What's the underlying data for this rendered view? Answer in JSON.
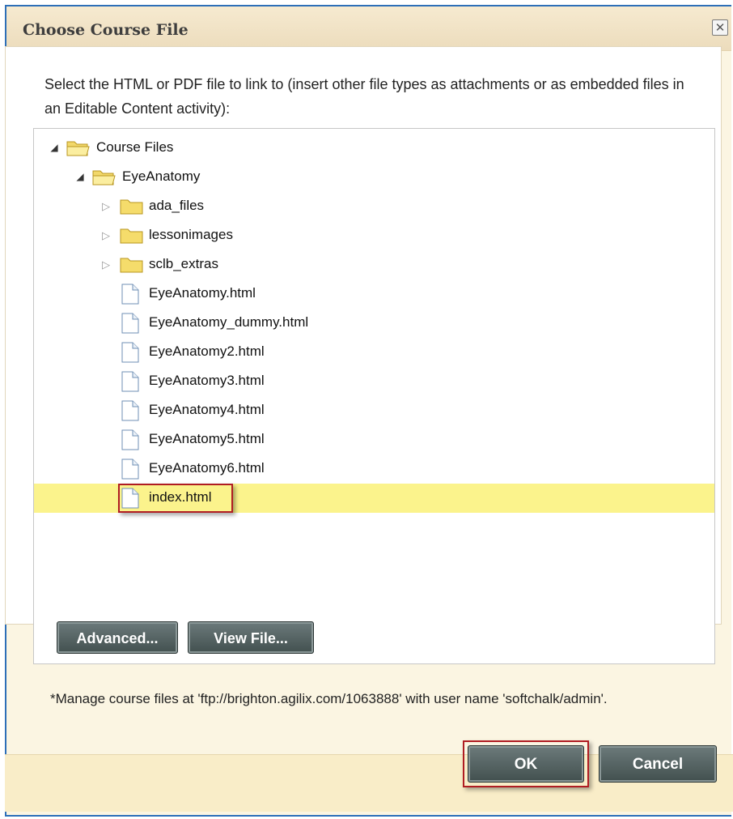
{
  "dialog": {
    "title": "Choose Course File",
    "close_symbol": "✕",
    "instructions": "Select the HTML or PDF file to link to (insert other file types as attachments or as embedded files in an Editable Content activity):",
    "footnote": "*Manage course files at 'ftp://brighton.agilix.com/1063888' with user name 'softchalk/admin'."
  },
  "tree": {
    "items": [
      {
        "label": "Course Files",
        "type": "folder",
        "state": "expanded",
        "depth": 0,
        "icon": "open-folder-icon"
      },
      {
        "label": "EyeAnatomy",
        "type": "folder",
        "state": "expanded",
        "depth": 1,
        "icon": "open-folder-icon"
      },
      {
        "label": "ada_files",
        "type": "folder",
        "state": "collapsed",
        "depth": 2,
        "icon": "folder-icon"
      },
      {
        "label": "lessonimages",
        "type": "folder",
        "state": "collapsed",
        "depth": 2,
        "icon": "folder-icon"
      },
      {
        "label": "sclb_extras",
        "type": "folder",
        "state": "collapsed",
        "depth": 2,
        "icon": "folder-icon"
      },
      {
        "label": "EyeAnatomy.html",
        "type": "file",
        "depth": 2,
        "icon": "file-icon"
      },
      {
        "label": "EyeAnatomy_dummy.html",
        "type": "file",
        "depth": 2,
        "icon": "file-icon"
      },
      {
        "label": "EyeAnatomy2.html",
        "type": "file",
        "depth": 2,
        "icon": "file-icon"
      },
      {
        "label": "EyeAnatomy3.html",
        "type": "file",
        "depth": 2,
        "icon": "file-icon"
      },
      {
        "label": "EyeAnatomy4.html",
        "type": "file",
        "depth": 2,
        "icon": "file-icon"
      },
      {
        "label": "EyeAnatomy5.html",
        "type": "file",
        "depth": 2,
        "icon": "file-icon"
      },
      {
        "label": "EyeAnatomy6.html",
        "type": "file",
        "depth": 2,
        "icon": "file-icon"
      },
      {
        "label": "index.html",
        "type": "file",
        "depth": 2,
        "icon": "file-icon",
        "selected": true
      }
    ],
    "advanced_label": "Advanced...",
    "view_file_label": "View File..."
  },
  "buttons": {
    "ok_label": "OK",
    "cancel_label": "Cancel"
  },
  "colors": {
    "selection": "#fbf38c",
    "highlight_border": "#b01c22",
    "button_bg": "#4d5b5b",
    "dialog_bg": "#fbf5e2",
    "window_border": "#2d6fb8"
  }
}
